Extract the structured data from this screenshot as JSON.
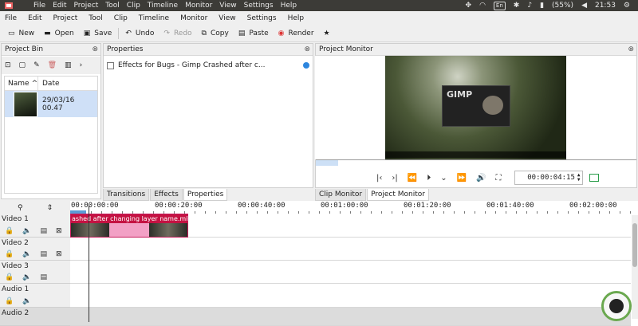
{
  "system_menu": [
    "File",
    "Edit",
    "Project",
    "Tool",
    "Clip",
    "Timeline",
    "Monitor",
    "View",
    "Settings",
    "Help"
  ],
  "tray": {
    "keyboard": "En",
    "battery": "(55%)",
    "time": "21:53"
  },
  "menubar": [
    "File",
    "Edit",
    "Project",
    "Tool",
    "Clip",
    "Timeline",
    "Monitor",
    "View",
    "Settings",
    "Help"
  ],
  "toolbar": {
    "new": "New",
    "open": "Open",
    "save": "Save",
    "undo": "Undo",
    "redo": "Redo",
    "copy": "Copy",
    "paste": "Paste",
    "render": "Render"
  },
  "project_bin": {
    "title": "Project Bin",
    "col_name": "Name",
    "col_date": "Date",
    "item_date": "29/03/16 00.47"
  },
  "properties": {
    "title": "Properties",
    "effect_label": "Effects for Bugs - Gimp Crashed after c..."
  },
  "properties_tabs": [
    "Transitions",
    "Effects",
    "Properties"
  ],
  "project_monitor": {
    "title": "Project Monitor",
    "gimp_text": "GIMP",
    "timecode": "00:00:04:15"
  },
  "monitor_tabs": [
    "Clip Monitor",
    "Project Monitor"
  ],
  "timeline": {
    "ruler_labels": [
      "00:00:00:00",
      "00:00:20:00",
      "00:00:40:00",
      "00:01:00:00",
      "00:01:20:00",
      "00:01:40:00",
      "00:02:00:00"
    ],
    "tracks": [
      {
        "name": "Video 1"
      },
      {
        "name": "Video 2"
      },
      {
        "name": "Video 3"
      },
      {
        "name": "Audio 1"
      },
      {
        "name": "Audio 2"
      }
    ],
    "clip_title": "ashed after changing layer name.mkv"
  },
  "colors": {
    "clip": "#e84a86",
    "clip_title_bg": "#c41242",
    "selection": "#cfe0f7"
  }
}
